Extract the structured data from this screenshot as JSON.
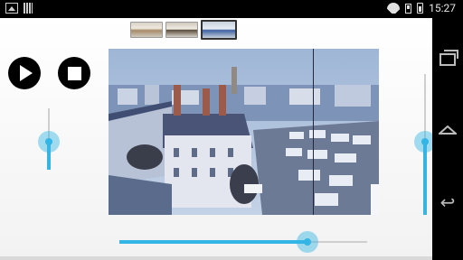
{
  "status_bar": {
    "time": "15:27",
    "icons": [
      "image-icon",
      "bars-icon",
      "wifi-icon",
      "sim-icon",
      "battery-icon"
    ]
  },
  "navigation": {
    "buttons": [
      "recent-apps-icon",
      "home-icon",
      "back-icon"
    ]
  },
  "player": {
    "thumbnails": [
      {
        "name": "thumbnail-1",
        "selected": false
      },
      {
        "name": "thumbnail-2",
        "selected": false
      },
      {
        "name": "thumbnail-3",
        "selected": true
      }
    ],
    "controls": [
      "play-icon",
      "stop-icon"
    ],
    "left_slider_fraction": 0.45,
    "right_slider_fraction": 0.52,
    "seek_fraction": 0.76
  },
  "colors": {
    "accent": "#33b5e5",
    "background": "#ffffff",
    "bars": "#000000"
  }
}
